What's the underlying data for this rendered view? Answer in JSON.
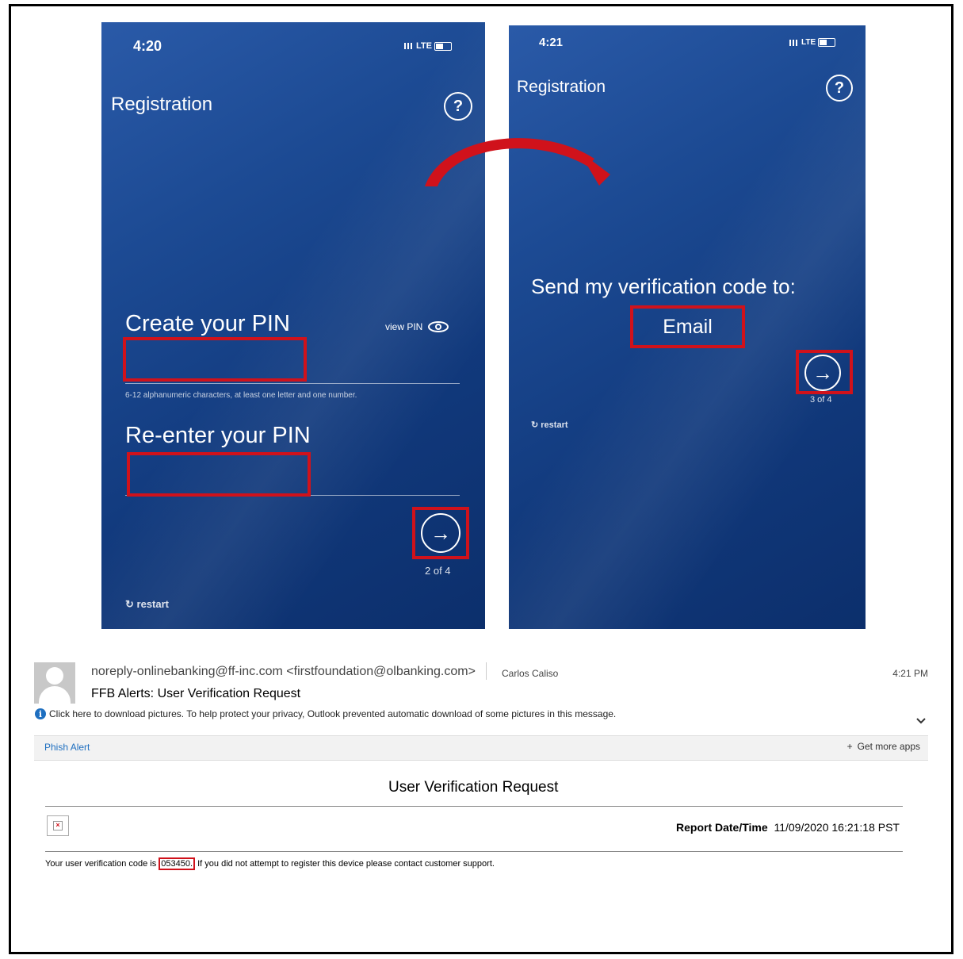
{
  "phone1": {
    "time": "4:20",
    "network": "LTE",
    "title": "Registration",
    "help": "?",
    "create_pin_label": "Create your PIN",
    "view_pin_label": "view PIN",
    "pin_hint": "6-12 alphanumeric characters, at least one letter and one number.",
    "reenter_pin_label": "Re-enter your PIN",
    "next_icon": "→",
    "step": "2 of 4",
    "restart_label": "restart"
  },
  "phone2": {
    "time": "4:21",
    "network": "LTE",
    "title": "Registration",
    "help": "?",
    "send_label": "Send my verification code to:",
    "option": "Email",
    "next_icon": "→",
    "step": "3 of 4",
    "restart_label": "restart"
  },
  "email": {
    "from": "noreply-onlinebanking@ff-inc.com <firstfoundation@olbanking.com>",
    "to": "Carlos Caliso",
    "time": "4:21 PM",
    "subject": "FFB Alerts: User Verification Request",
    "info_notice": "Click here to download pictures. To help protect your privacy, Outlook prevented automatic download of some pictures in this message.",
    "addin_label": "Phish Alert",
    "get_apps_label": "Get more apps",
    "body_title": "User Verification Request",
    "report_label": "Report Date/Time",
    "report_value": "11/09/2020 16:21:18 PST",
    "body_prefix": "Your user verification code is",
    "code": "053450.",
    "body_suffix": "If you did not attempt to register this device please contact customer support."
  },
  "colors": {
    "highlight": "#d0121b",
    "link": "#1e6fc0",
    "phone_bg": "#16418a"
  }
}
